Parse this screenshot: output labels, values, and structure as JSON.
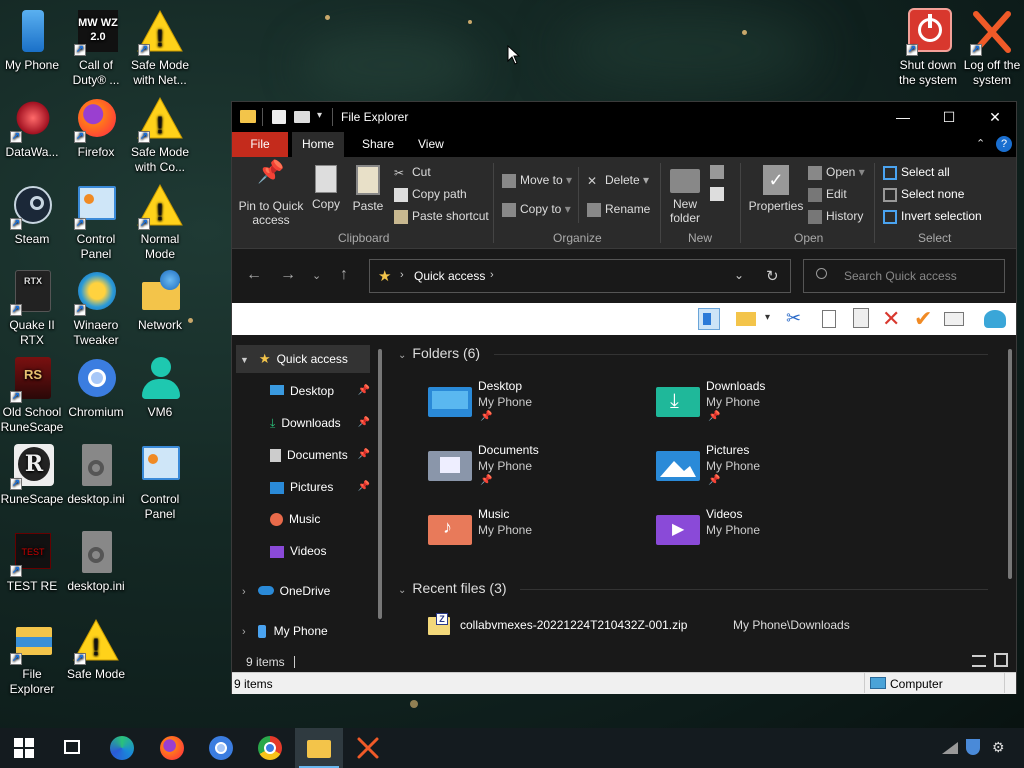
{
  "desktop": {
    "icons": [
      {
        "label": "My Phone"
      },
      {
        "label": "Call of Duty® ..."
      },
      {
        "label": "Safe Mode with Net..."
      },
      {
        "label": "DataWa..."
      },
      {
        "label": "Firefox"
      },
      {
        "label": "Safe Mode with Co..."
      },
      {
        "label": "Steam"
      },
      {
        "label": "Control Panel"
      },
      {
        "label": "Normal Mode"
      },
      {
        "label": "Quake II RTX"
      },
      {
        "label": "Winaero Tweaker"
      },
      {
        "label": "Network"
      },
      {
        "label": "Old School RuneScape"
      },
      {
        "label": "Chromium"
      },
      {
        "label": "VM6"
      },
      {
        "label": "RuneScape"
      },
      {
        "label": "desktop.ini"
      },
      {
        "label": "Control Panel"
      },
      {
        "label": "TEST RE"
      },
      {
        "label": "desktop.ini"
      },
      {
        "label": "File Explorer"
      },
      {
        "label": "Safe Mode"
      },
      {
        "label": "Shut down the system"
      },
      {
        "label": "Log off the system"
      }
    ],
    "cod_badge": "MW WZ 2.0",
    "rtx_badge": "RTX",
    "rs_badge": "RS",
    "r_badge": "R",
    "test_badge": "TEST"
  },
  "window": {
    "title": "File Explorer",
    "min": "—",
    "max": "☐",
    "close": "✕"
  },
  "ribbon": {
    "tabs": [
      "File",
      "Home",
      "Share",
      "View"
    ],
    "pin_label": "Pin to Quick access",
    "copy": "Copy",
    "paste": "Paste",
    "cut": "Cut",
    "copy_path": "Copy path",
    "paste_shortcut": "Paste shortcut",
    "move_to": "Move to",
    "copy_to": "Copy to",
    "delete": "Delete",
    "rename": "Rename",
    "new_folder": "New folder",
    "properties": "Properties",
    "open": "Open",
    "edit": "Edit",
    "history": "History",
    "select_all": "Select all",
    "select_none": "Select none",
    "invert_selection": "Invert selection",
    "groups": [
      "Clipboard",
      "Organize",
      "New",
      "Open",
      "Select"
    ]
  },
  "address": {
    "path": "Quick access",
    "search_placeholder": "Search Quick access"
  },
  "navpane": {
    "items": [
      {
        "label": "Quick access"
      },
      {
        "label": "Desktop"
      },
      {
        "label": "Downloads"
      },
      {
        "label": "Documents"
      },
      {
        "label": "Pictures"
      },
      {
        "label": "Music"
      },
      {
        "label": "Videos"
      },
      {
        "label": "OneDrive"
      },
      {
        "label": "My Phone"
      }
    ]
  },
  "content": {
    "folders_header": "Folders (6)",
    "folders": [
      {
        "name": "Desktop",
        "location": "My Phone"
      },
      {
        "name": "Downloads",
        "location": "My Phone"
      },
      {
        "name": "Documents",
        "location": "My Phone"
      },
      {
        "name": "Pictures",
        "location": "My Phone"
      },
      {
        "name": "Music",
        "location": "My Phone"
      },
      {
        "name": "Videos",
        "location": "My Phone"
      }
    ],
    "recent_header": "Recent files (3)",
    "recent": [
      {
        "name": "collabvmexes-20221224T210432Z-001.zip",
        "path": "My Phone\\Downloads"
      }
    ]
  },
  "status": {
    "items_count": "9 items",
    "items_count_bar": "9 items",
    "zone": "Computer"
  },
  "colors": {
    "file_tab": "#c42b1c",
    "accent": "#0078d4"
  }
}
